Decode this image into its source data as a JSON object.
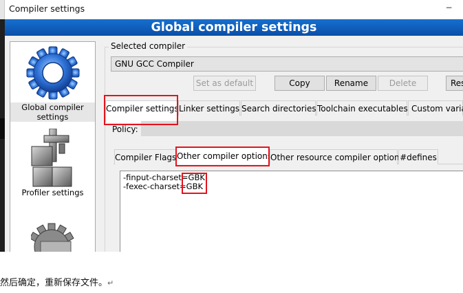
{
  "window": {
    "title": "Compiler settings",
    "minimize_glyph": "−",
    "banner": "Global compiler settings"
  },
  "categories": [
    {
      "label": "Global compiler settings",
      "icon": "gear-icon",
      "selected": true
    },
    {
      "label": "Profiler settings",
      "icon": "profiler-icon",
      "selected": false
    },
    {
      "label": "",
      "icon": "gear-icon",
      "selected": false
    }
  ],
  "selected_compiler": {
    "group_label": "Selected compiler",
    "value": "GNU GCC Compiler"
  },
  "buttons": {
    "set_default": "Set as default",
    "copy": "Copy",
    "rename": "Rename",
    "delete": "Delete",
    "reset": "Res"
  },
  "main_tabs": [
    "Compiler settings",
    "Linker settings",
    "Search directories",
    "Toolchain executables",
    "Custom variab"
  ],
  "policy_label": "Policy:",
  "sub_tabs": [
    "Compiler Flags",
    "Other compiler options",
    "Other resource compiler options",
    "#defines"
  ],
  "editor": {
    "lines": [
      {
        "prefix": "-finput-charset=",
        "value": "GBK"
      },
      {
        "prefix": "-fexec-charset=",
        "value": "GBK"
      }
    ]
  },
  "annotation_color": "#e2141c",
  "below": {
    "text": "然后确定，重新保存文件。",
    "mark": "↵"
  }
}
